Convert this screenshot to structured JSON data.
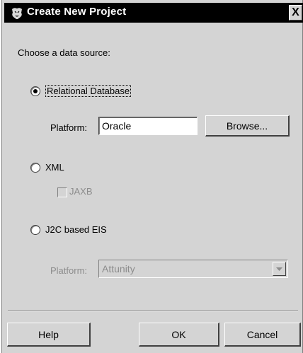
{
  "window": {
    "title": "Create New Project",
    "close_label": "X"
  },
  "main": {
    "prompt": "Choose a data source:",
    "options": [
      {
        "label": "Relational Database",
        "selected": true
      },
      {
        "label": "XML",
        "selected": false
      },
      {
        "label": "J2C based EIS",
        "selected": false
      }
    ],
    "relational": {
      "platform_label": "Platform:",
      "platform_value": "Oracle",
      "browse_label": "Browse..."
    },
    "xml": {
      "jaxb_label": "JAXB",
      "jaxb_checked": false
    },
    "eis": {
      "platform_label": "Platform:",
      "platform_value": "Attunity"
    }
  },
  "footer": {
    "help_label": "Help",
    "ok_label": "OK",
    "cancel_label": "Cancel"
  }
}
